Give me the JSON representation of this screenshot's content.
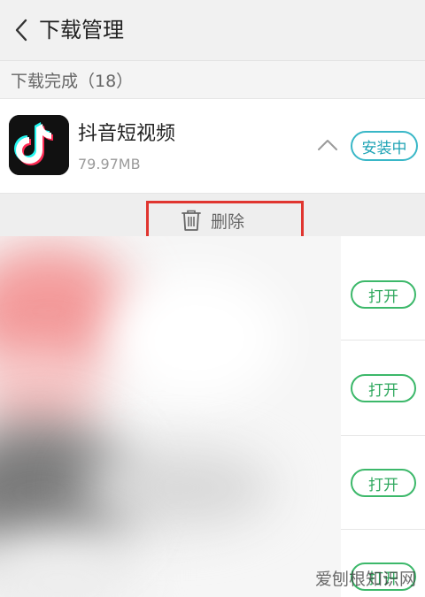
{
  "header": {
    "title": "下载管理",
    "back_icon": "chevron-left-icon"
  },
  "section": {
    "label": "下载完成（18）"
  },
  "active_item": {
    "name": "抖音短视频",
    "size": "79.97MB",
    "status_button": "安装中",
    "icon": "tiktok-app-icon",
    "expand_icon": "chevron-up-icon"
  },
  "actions": {
    "delete_label": "删除",
    "delete_icon": "trash-icon",
    "highlight_color": "#e0352f"
  },
  "items": [
    {
      "button_label": "打开"
    },
    {
      "button_label": "打开"
    },
    {
      "button_label": "打开"
    },
    {
      "button_label": "打开"
    }
  ],
  "watermark": "爱刨根知识网",
  "colors": {
    "accent_green": "#3cb86a",
    "accent_cyan": "#39b7c7"
  }
}
